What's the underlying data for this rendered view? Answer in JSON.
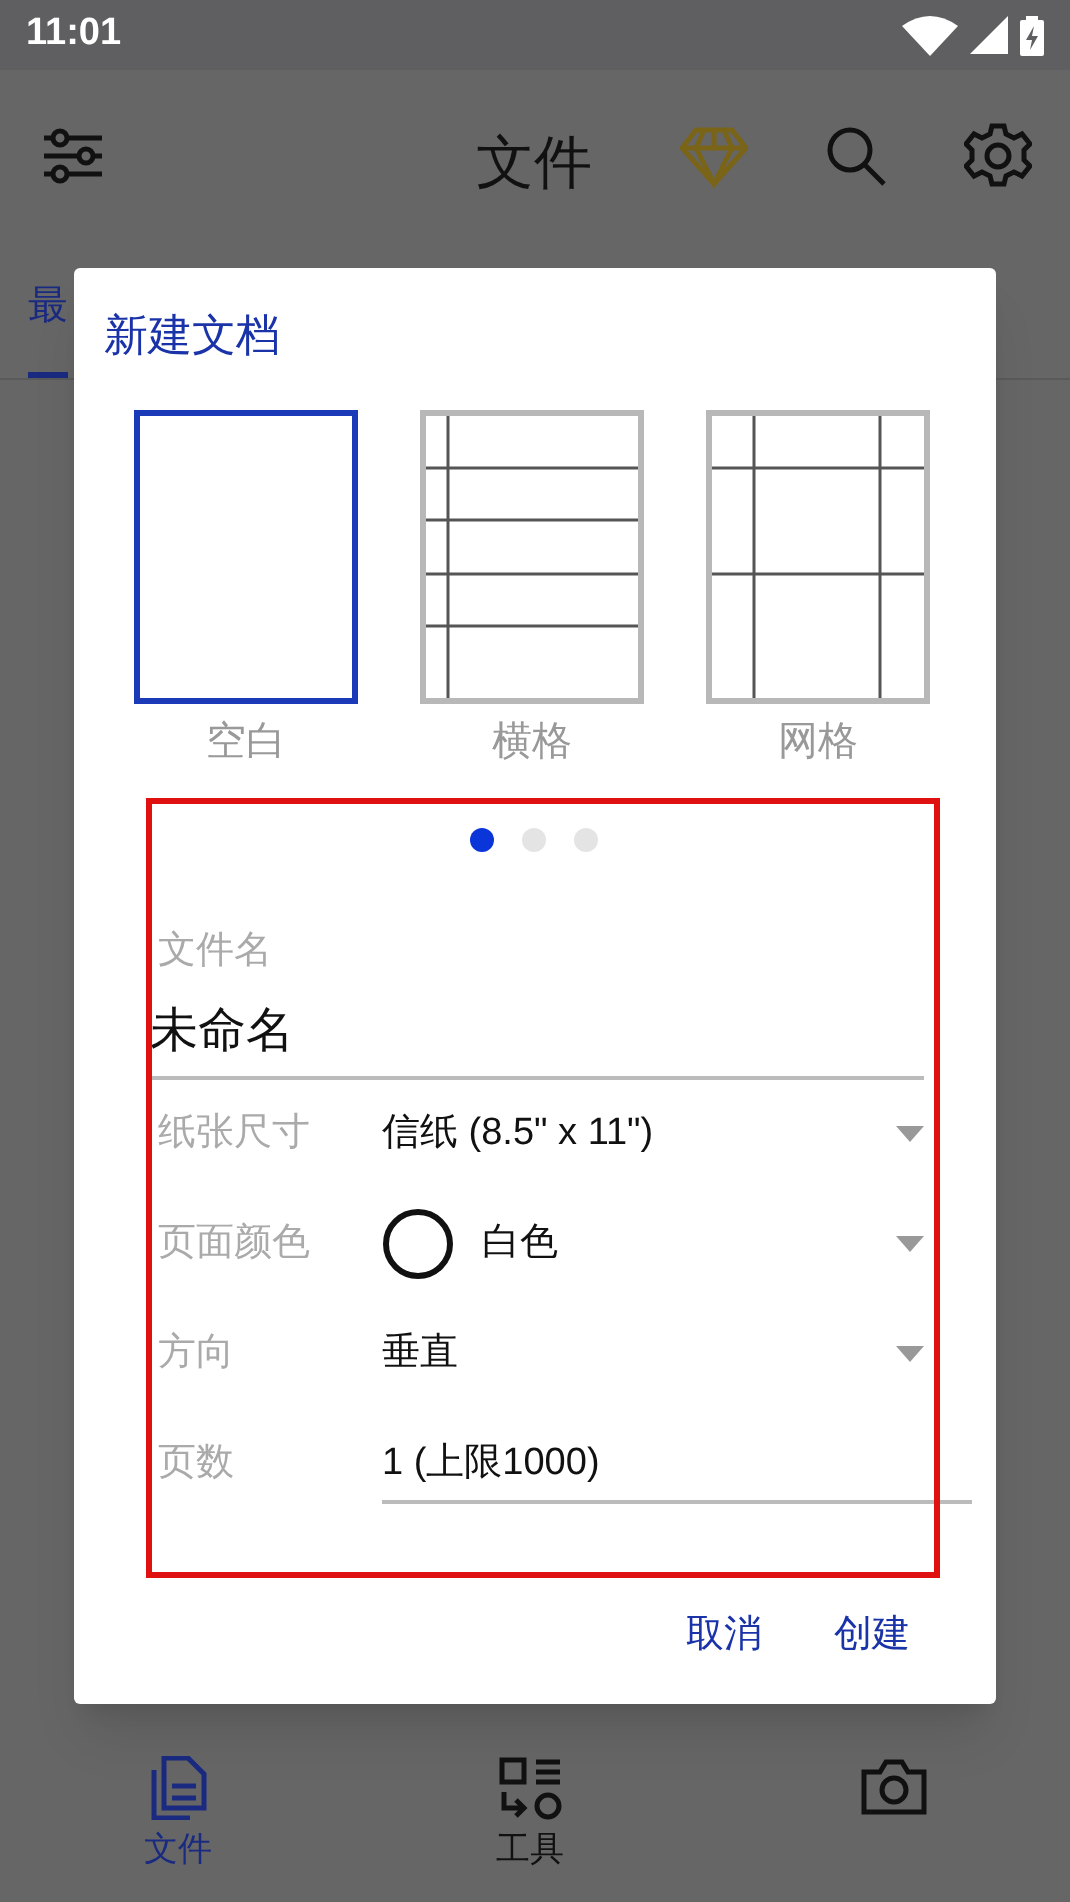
{
  "status_bar": {
    "time": "11:01"
  },
  "app_bar": {
    "title": "文件"
  },
  "tabs": [
    {
      "label": "最",
      "selected": true
    }
  ],
  "dialog": {
    "title": "新建文档",
    "templates": [
      {
        "kind": "blank",
        "label": "空白",
        "selected": true
      },
      {
        "kind": "lined",
        "label": "横格",
        "selected": false
      },
      {
        "kind": "grid",
        "label": "网格",
        "selected": false
      }
    ],
    "pages": [
      {
        "selected": true
      },
      {
        "selected": false
      },
      {
        "selected": false
      }
    ],
    "fields": [
      {
        "kind": "text",
        "label": "文件名",
        "value": "未命名"
      },
      {
        "kind": "select",
        "label": "纸张尺寸",
        "value": "信纸 (8.5\" x 11\")"
      },
      {
        "kind": "color-select",
        "label": "页面颜色",
        "value": "白色"
      },
      {
        "kind": "select",
        "label": "方向",
        "value": "垂直"
      },
      {
        "kind": "number",
        "label": "页数",
        "value": "1 (上限1000)"
      }
    ],
    "buttons": [
      "取消",
      "创建"
    ]
  },
  "bottom_nav": [
    {
      "kind": "files",
      "label": "文件",
      "selected": true
    },
    {
      "kind": "tools",
      "label": "工具",
      "selected": false
    },
    {
      "kind": "camera",
      "selected": false
    }
  ]
}
